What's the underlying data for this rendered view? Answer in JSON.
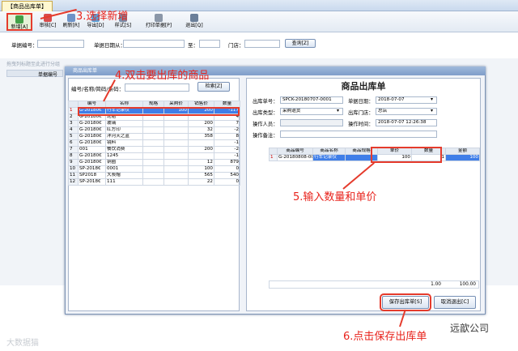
{
  "window": {
    "tab_title": "【商品出库单】"
  },
  "toolbar": {
    "new": "新增[A]",
    "audit": "审核[C]",
    "refresh": "刷新[R]",
    "export": "导出[D]",
    "style": "样式[S]",
    "print": "打印单据[P]",
    "exit": "退出[Q]"
  },
  "filter": {
    "doc_no_label": "单据编号：",
    "date_label": "单据日期从：",
    "to_label": "至：",
    "store_label": "门店：",
    "query_btn": "查询[Z]"
  },
  "bg": {
    "hint": "拖曳列标题至此进行分组",
    "header_col": "单据编号"
  },
  "dialog": {
    "title": "商品出库单"
  },
  "product_search": {
    "label": "编号/名称/简码/条码：",
    "button": "检索[Z]"
  },
  "product_table": {
    "headers": [
      "",
      "编号",
      "名称",
      "规格",
      "采购价",
      "销售价",
      "数量"
    ],
    "rows": [
      [
        "1",
        "G-20180€",
        "行车记录仪",
        "",
        "100",
        "200",
        "-117"
      ],
      [
        "2",
        "G-20180€",
        "轮胎",
        "",
        "",
        "",
        "4"
      ],
      [
        "3",
        "G-20180€",
        "玻璃",
        "",
        "",
        "200",
        "7"
      ],
      [
        "4",
        "G-20180€",
        "红方印",
        "",
        "",
        "32",
        "-2"
      ],
      [
        "5",
        "G-20180€",
        "洋河天之蓝",
        "",
        "",
        "358",
        "8"
      ],
      [
        "6",
        "G-20180€",
        "镜料",
        "",
        "",
        "",
        "-1"
      ],
      [
        "7",
        "001",
        "餐饮消费",
        "",
        "",
        "200",
        "-2"
      ],
      [
        "8",
        "G-20180€",
        "1245",
        "",
        "",
        "",
        "-1"
      ],
      [
        "9",
        "G-20180€",
        "铜圈",
        "",
        "",
        "12",
        "879"
      ],
      [
        "10",
        "SP-2018€",
        "0001",
        "",
        "",
        "100",
        "0"
      ],
      [
        "11",
        "SP2018",
        "大炭帽",
        "",
        "",
        "565",
        "540"
      ],
      [
        "12",
        "SP-2018€",
        "111",
        "",
        "",
        "22",
        "0"
      ]
    ]
  },
  "form": {
    "title": "商品出库单",
    "doc_no_label": "出库单号：",
    "doc_no": "SPCK-20180707-0001",
    "doc_date_label": "单据日期：",
    "doc_date": "2018-07-07",
    "type_label": "出库类型：",
    "type": "采购退货",
    "store_label": "出库门店：",
    "store": "总店",
    "operator_label": "操作人员：",
    "operator": "",
    "op_time_label": "操作时间：",
    "op_time": "2018-07-07 12:26:38",
    "remark_label": "操作备注：",
    "remark": ""
  },
  "detail_table": {
    "headers": [
      "",
      "商品编号",
      "商品名称",
      "商品规格",
      "单价",
      "数量",
      "金额"
    ],
    "rows": [
      [
        "1",
        "G-20180808-000",
        "行车记录仪",
        "",
        "100",
        "1",
        "100"
      ]
    ]
  },
  "totals": {
    "qty": "1.00",
    "amount": "100.00"
  },
  "buttons": {
    "save": "保存出库单[S]",
    "cancel": "取消退出[C]"
  },
  "annotations": {
    "step3": "3.选择新增",
    "step4": "4.双击要出库的商品",
    "step5": "5.输入数量和单价",
    "step6": "6.点击保存出库单"
  },
  "watermarks": {
    "left": "大数据猫",
    "right": "远歆公司"
  },
  "colors": {
    "accent": "#e53b2c",
    "selection": "#3f7ee8"
  }
}
